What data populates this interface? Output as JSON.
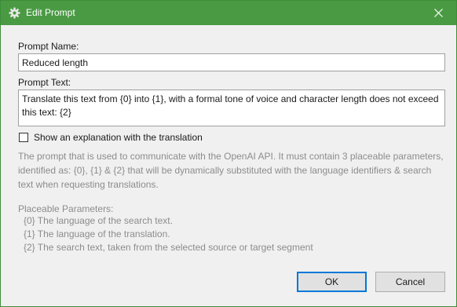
{
  "window": {
    "title": "Edit Prompt",
    "title_icon": "gear-icon",
    "close_icon": "close-icon",
    "titlebar_color": "#4a9a43"
  },
  "form": {
    "name_label": "Prompt Name:",
    "name_value": "Reduced length",
    "text_label": "Prompt Text:",
    "text_value": "Translate this text from {0} into {1}, with a formal tone of voice and character length does not exceed this text: {2}",
    "checkbox_label": "Show an explanation with the translation",
    "checkbox_checked": false
  },
  "help": {
    "description_lines": [
      "The prompt that is used to communicate with the OpenAI API. It must contain 3 placeable parameters,",
      "identified as: {0}, {1} & {2} that will be dynamically substituted with the language identifiers & search",
      "text when requesting translations."
    ],
    "params_heading": "Placeable Parameters:",
    "params": [
      "{0} The language of the search text.",
      "{1} The language of the translation.",
      "{2} The search text, taken from the selected source or target segment"
    ]
  },
  "buttons": {
    "ok_label": "OK",
    "cancel_label": "Cancel"
  }
}
